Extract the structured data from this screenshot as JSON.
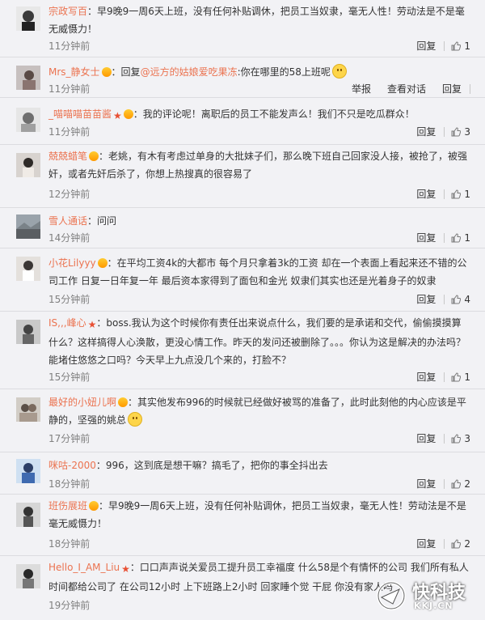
{
  "comments": [
    {
      "user": "宗政写百",
      "badge": "",
      "reply_to": "",
      "text": "：早9晚9一周6天上班，没有任何补贴调休，把员工当奴隶，毫无人性！劳动法是不是毫无威慑力！",
      "time": "11分钟前",
      "actions": [
        "回复"
      ],
      "likes": "1",
      "emoji": false
    },
    {
      "user": "Mrs_静女士",
      "badge": "vip",
      "reply_to": "@远方的姑娘爱吃果冻",
      "text": "：回复@远方的姑娘爱吃果冻:你在哪里的58上班呢",
      "time": "11分钟前",
      "actions": [
        "举报",
        "查看对话",
        "回复"
      ],
      "likes": "",
      "emoji": true
    },
    {
      "user": "_喵喵喵苗苗酱",
      "badge": "star-vip",
      "reply_to": "",
      "text": "：我的评论呢！离职后的员工不能发声么！我们不只是吃瓜群众！",
      "time": "11分钟前",
      "actions": [
        "回复"
      ],
      "likes": "3",
      "emoji": false
    },
    {
      "user": "兢兢蜡笔",
      "badge": "vip",
      "reply_to": "",
      "text": "：老姚，有木有考虑过单身的大批妹子们，那么晚下班自己回家没人接，被抢了，被强奸，或者先奸后杀了，你想上热搜真的很容易了",
      "time": "12分钟前",
      "actions": [
        "回复"
      ],
      "likes": "1",
      "emoji": false
    },
    {
      "user": "雪人通话",
      "badge": "",
      "reply_to": "",
      "text": "：问问",
      "time": "14分钟前",
      "actions": [
        "回复"
      ],
      "likes": "1",
      "emoji": false
    },
    {
      "user": "小花Lilyyy",
      "badge": "vip",
      "reply_to": "",
      "text": "：在平均工资4k的大都市 每个月只拿着3k的工资 却在一个表面上看起来还不错的公司工作 日复一日年复一年 最后资本家得到了面包和金光 奴隶们其实也还是光着身子的奴隶",
      "time": "15分钟前",
      "actions": [
        "回复"
      ],
      "likes": "4",
      "emoji": false
    },
    {
      "user": "IS,,,峰心",
      "badge": "star",
      "reply_to": "",
      "text": "：boss.我认为这个时候你有责任出来说点什么，我们要的是承诺和交代，偷偷摸摸算什么？这样搞得人心涣散，更没心情工作。昨天的发问还被删除了。。。你认为这是解决的办法吗？能堵住悠悠之口吗？今天早上九点没几个来的，打脸不？",
      "time": "15分钟前",
      "actions": [
        "回复"
      ],
      "likes": "1",
      "emoji": false
    },
    {
      "user": "最好的小妞儿啊",
      "badge": "vip",
      "reply_to": "",
      "text": "：其实他发布996的时候就已经做好被骂的准备了，此时此刻他的内心应该是平静的，坚强的姚总",
      "time": "17分钟前",
      "actions": [
        "回复"
      ],
      "likes": "3",
      "emoji": true
    },
    {
      "user": "咪咕-2000",
      "badge": "",
      "reply_to": "",
      "text": "：996，这到底是想干嘛？搞毛了，把你的事全抖出去",
      "time": "18分钟前",
      "actions": [
        "回复"
      ],
      "likes": "2",
      "emoji": false
    },
    {
      "user": "班伤展班",
      "badge": "vip",
      "reply_to": "",
      "text": "：早9晚9一周6天上班，没有任何补贴调休，把员工当奴隶，毫无人性！劳动法是不是毫无威慑力！",
      "time": "18分钟前",
      "actions": [
        "回复"
      ],
      "likes": "2",
      "emoji": false
    },
    {
      "user": "Hello_I_AM_Liu",
      "badge": "star",
      "reply_to": "",
      "text": "：口口声声说关爱员工提升员工幸福度 什么58是个有情怀的公司 我们所有私人时间都给公司了 在公司12小时 上下班路上2小时 回家睡个觉 干屁 你没有家人吗",
      "time": "19分钟前",
      "actions": [],
      "likes": "",
      "emoji": false
    }
  ],
  "watermark": {
    "name": "快科技",
    "url": "KKJ.CN"
  },
  "colors": {
    "username": "#eb7350",
    "time": "#808080",
    "background": "#f2f2f5"
  }
}
